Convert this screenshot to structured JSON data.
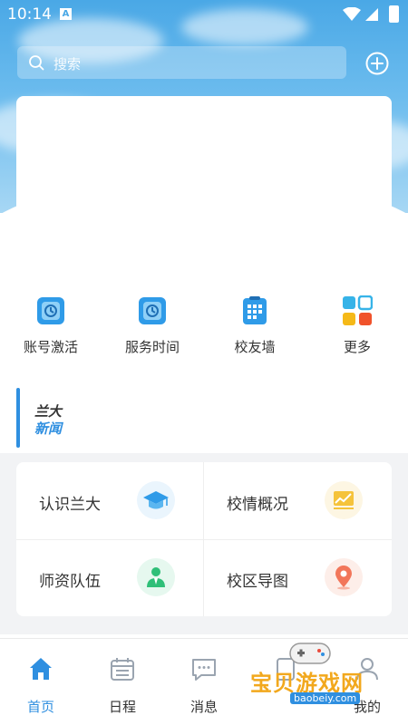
{
  "status_bar": {
    "time": "10:14",
    "badge": "A"
  },
  "search": {
    "placeholder": "搜索"
  },
  "quick_entries": [
    {
      "label": "账号激活",
      "icon": "account-activate-icon"
    },
    {
      "label": "服务时间",
      "icon": "service-time-icon"
    },
    {
      "label": "校友墙",
      "icon": "alumni-wall-icon"
    },
    {
      "label": "更多",
      "icon": "more-grid-icon"
    }
  ],
  "news_section": {
    "line1": "兰大",
    "line2": "新闻"
  },
  "grid": [
    {
      "label": "认识兰大",
      "icon": "graduation-cap-icon"
    },
    {
      "label": "校情概况",
      "icon": "chart-board-icon"
    },
    {
      "label": "师资队伍",
      "icon": "teacher-icon"
    },
    {
      "label": "校区导图",
      "icon": "map-pin-icon"
    }
  ],
  "tabs": [
    {
      "label": "首页",
      "icon": "home-icon",
      "active": true
    },
    {
      "label": "日程",
      "icon": "calendar-icon",
      "active": false
    },
    {
      "label": "消息",
      "icon": "message-icon",
      "active": false
    },
    {
      "label": "",
      "icon": "lab-icon",
      "active": false
    },
    {
      "label": "我的",
      "icon": "profile-icon",
      "active": false
    }
  ],
  "watermark": {
    "title": "宝贝游戏网",
    "url": "baobeiy.com"
  },
  "colors": {
    "accent": "#2f8fe0",
    "sky": "#4aa8e6"
  }
}
